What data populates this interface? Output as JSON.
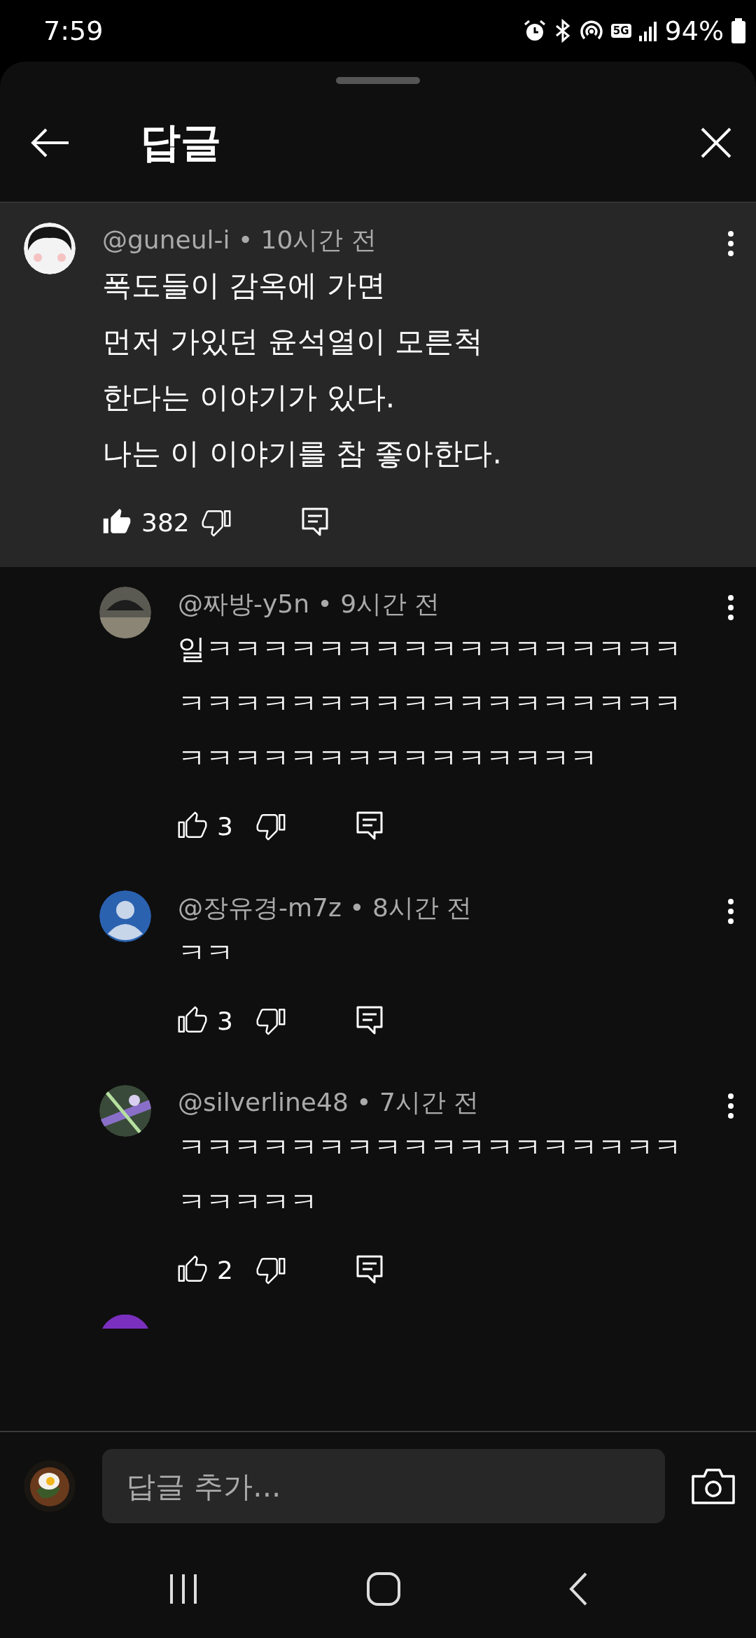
{
  "status_bar": {
    "time": "7:59",
    "network": "5G",
    "battery": "94%"
  },
  "sheet": {
    "title": "답글"
  },
  "comment": {
    "meta": "@guneul-i • 10시간 전",
    "lines": [
      "폭도들이 감옥에 가면",
      "먼저 가있던 윤석열이 모른척",
      "한다는 이야기가 있다.",
      "나는 이 이야기를 참 좋아한다."
    ],
    "likes": "382",
    "liked": true
  },
  "replies": [
    {
      "meta": "@짜방-y5n • 9시간 전",
      "lines": [
        "일ㅋㅋㅋㅋㅋㅋㅋㅋㅋㅋㅋㅋㅋㅋㅋㅋㅋ",
        "ㅋㅋㅋㅋㅋㅋㅋㅋㅋㅋㅋㅋㅋㅋㅋㅋㅋㅋ",
        "ㅋㅋㅋㅋㅋㅋㅋㅋㅋㅋㅋㅋㅋㅋㅋ"
      ],
      "likes": "3",
      "liked": false
    },
    {
      "meta": "@장유경-m7z • 8시간 전",
      "lines": [
        "ㅋㅋ"
      ],
      "likes": "3",
      "liked": false
    },
    {
      "meta": "@silverline48 • 7시간 전",
      "lines": [
        "ㅋㅋㅋㅋㅋㅋㅋㅋㅋㅋㅋㅋㅋㅋㅋㅋㅋㅋ",
        "ㅋㅋㅋㅋㅋ"
      ],
      "likes": "2",
      "liked": false
    }
  ],
  "composer": {
    "placeholder": "답글 추가..."
  }
}
